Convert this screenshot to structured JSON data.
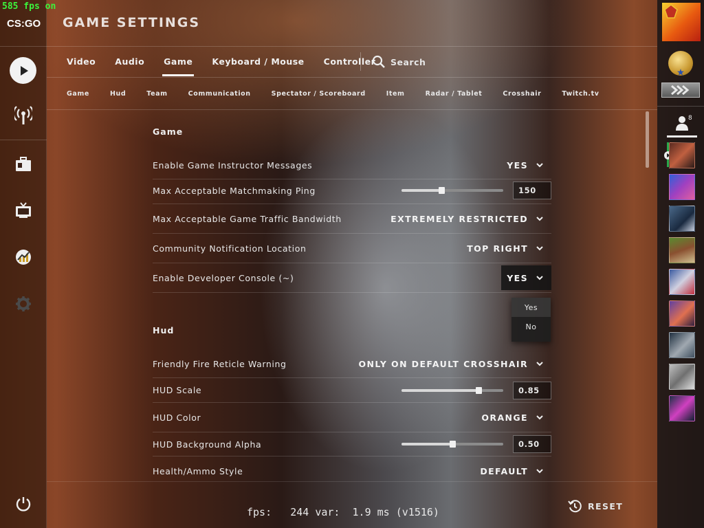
{
  "overlay": {
    "fps_counter": "585 fps on"
  },
  "brand": {
    "logo_text": "CS:GO"
  },
  "header": {
    "title": "GAME SETTINGS"
  },
  "tabs": [
    {
      "label": "Video"
    },
    {
      "label": "Audio"
    },
    {
      "label": "Game",
      "active": true
    },
    {
      "label": "Keyboard / Mouse"
    },
    {
      "label": "Controller"
    }
  ],
  "search": {
    "label": "Search"
  },
  "subtabs": [
    {
      "label": "Game"
    },
    {
      "label": "Hud"
    },
    {
      "label": "Team"
    },
    {
      "label": "Communication"
    },
    {
      "label": "Spectator / Scoreboard"
    },
    {
      "label": "Item"
    },
    {
      "label": "Radar / Tablet"
    },
    {
      "label": "Crosshair"
    },
    {
      "label": "Twitch.tv"
    }
  ],
  "sections": {
    "game": {
      "title": "Game",
      "rows": [
        {
          "label": "Enable Game Instructor Messages",
          "value": "YES"
        },
        {
          "label": "Max Acceptable Matchmaking Ping",
          "value": "150",
          "slider_fraction": 0.4
        },
        {
          "label": "Max Acceptable Game Traffic Bandwidth",
          "value": "EXTREMELY RESTRICTED"
        },
        {
          "label": "Community Notification Location",
          "value": "TOP RIGHT"
        },
        {
          "label": "Enable Developer Console (~)",
          "value": "YES"
        }
      ]
    },
    "hud": {
      "title": "Hud",
      "rows": [
        {
          "label": "Friendly Fire Reticle Warning",
          "value": "ONLY ON DEFAULT CROSSHAIR"
        },
        {
          "label": "HUD Scale",
          "value": "0.85",
          "slider_fraction": 0.76
        },
        {
          "label": "HUD Color",
          "value": "ORANGE"
        },
        {
          "label": "HUD Background Alpha",
          "value": "0.50",
          "slider_fraction": 0.5
        },
        {
          "label": "Health/Ammo Style",
          "value": "DEFAULT"
        }
      ]
    }
  },
  "dropdown_menu": {
    "options": [
      "Yes",
      "No"
    ],
    "highlighted": "Yes"
  },
  "footer": {
    "fps_line": "fps:   244 var:  1.9 ms (v1516)",
    "reset_label": "RESET"
  },
  "friends": {
    "count": "8"
  },
  "colors": {
    "accent_fps": "#3cf43c",
    "status_online": "#2aa84a"
  }
}
